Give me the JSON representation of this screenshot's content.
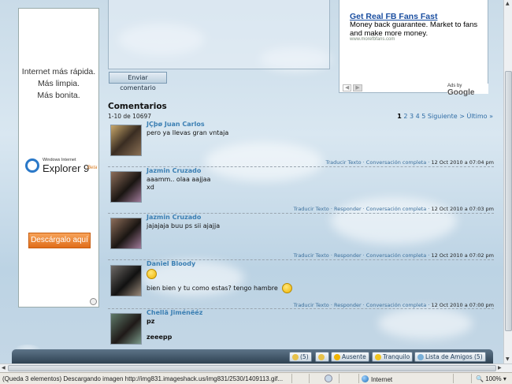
{
  "left_ad": {
    "line1": "Internet más rápida.",
    "line2": "Más limpia.",
    "line3": "Más bonita.",
    "brand_top": "Windows Internet",
    "brand_main": "Explorer 9",
    "brand_beta": "Beta",
    "cta": "Descárgalo aquí"
  },
  "send_button": "Enviar comentario",
  "google_ad": {
    "title": "Get Real FB Fans Fast",
    "desc": "Money back guarantee. Market to fans and make more money.",
    "url": "www.morefbfans.com",
    "ads_by": "Ads by",
    "google": "Google"
  },
  "comments": {
    "title": "Comentarios",
    "count": "1-10 de 10697",
    "pager": {
      "current": "1",
      "pages": "2 3 4 5",
      "next": "Siguiente >",
      "last": "Último »"
    },
    "items": [
      {
        "name": "JÇþø Juan Carlos",
        "text": "pero ya llevas gran vntaja",
        "actions": "Traducir Texto · Conversación completa ·",
        "date": "12 Oct 2010 a 07:04 pm"
      },
      {
        "name": "Jazmin Cruzado",
        "text": "aaamm.. olaa aajjaa",
        "text2": "xd",
        "actions": "Traducir Texto · Responder · Conversación completa ·",
        "date": "12 Oct 2010 a 07:03 pm"
      },
      {
        "name": "Jazmin Cruzado",
        "text": "jajajaja buu ps sii ajajja",
        "actions": "Traducir Texto · Responder · Conversación completa ·",
        "date": "12 Oct 2010 a 07:02 pm"
      },
      {
        "name": "Daniel Bloody",
        "text": "bien bien y tu como estas? tengo hambre",
        "actions": "Traducir Texto · Responder · Conversación completa ·",
        "date": "12 Oct 2010 a 07:00 pm"
      },
      {
        "name": "Chellä Jiménëéz",
        "text": "pz",
        "text2": "zeeepp"
      }
    ]
  },
  "chat_bar": {
    "count": "(5)",
    "status_away": "Ausente",
    "status_calm": "Tranquilo",
    "friends": "Lista de Amigos (5)"
  },
  "status_bar": {
    "message": "(Queda 3 elementos) Descargando imagen http://img831.imageshack.us/img831/2530/1409113.gif...",
    "zone": "Internet",
    "zoom": "100%"
  },
  "colors": {
    "link": "#3b7fb3",
    "cta_orange": "#e06d1a",
    "chatbar": "#2f4252"
  }
}
